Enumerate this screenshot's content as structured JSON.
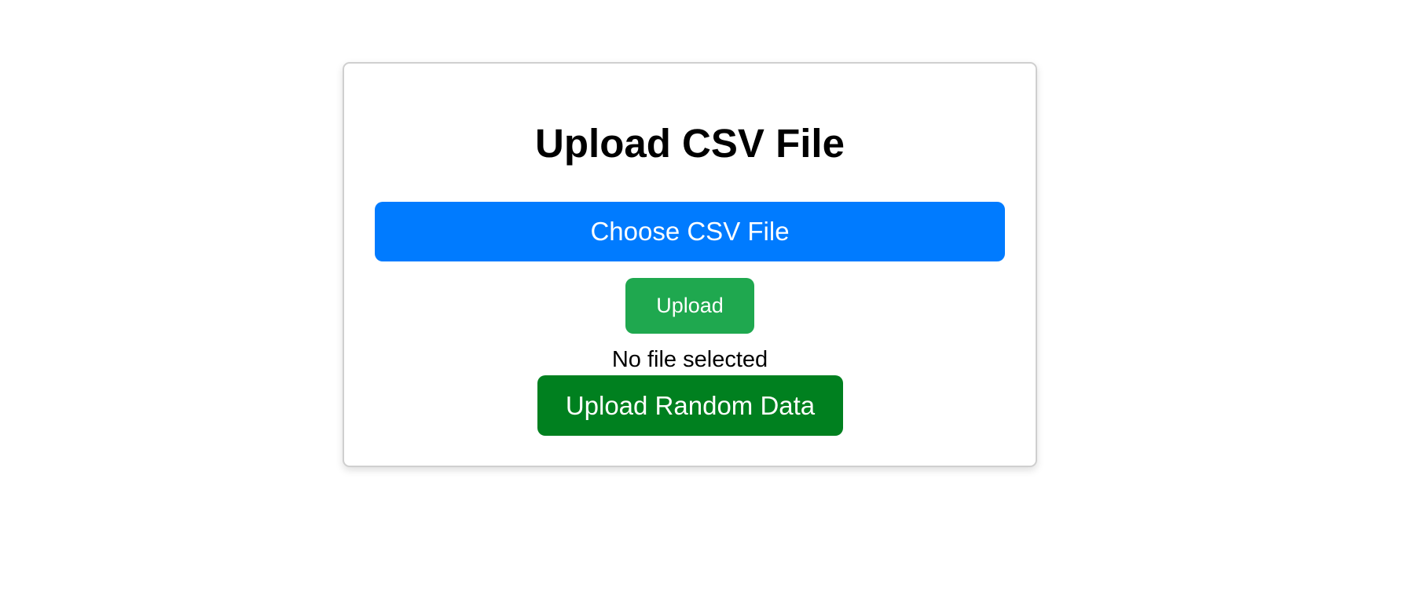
{
  "card": {
    "title": "Upload CSV File",
    "choose_label": "Choose CSV File",
    "upload_label": "Upload",
    "status_text": "No file selected",
    "random_label": "Upload Random Data"
  },
  "colors": {
    "choose_button": "#007bff",
    "upload_button": "#1fa84f",
    "random_button": "#00801f"
  }
}
